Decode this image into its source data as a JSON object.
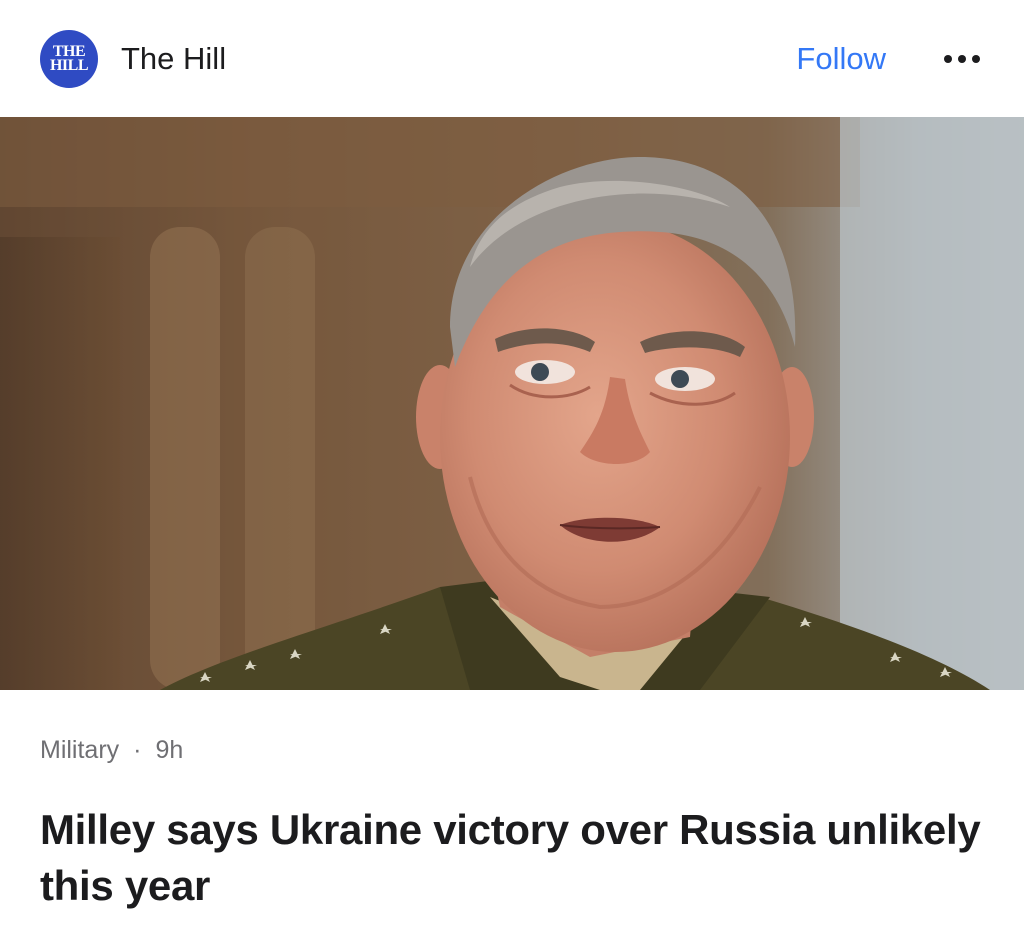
{
  "header": {
    "logo_text_line1": "THE",
    "logo_text_line2": "HILL",
    "source_name": "The Hill",
    "follow_label": "Follow",
    "more_icon": "ellipsis-icon"
  },
  "article": {
    "category": "Military",
    "separator": "·",
    "age": "9h",
    "headline": "Milley says Ukraine victory over Russia unlikely this year"
  },
  "colors": {
    "accent": "#3478f6",
    "logo_bg": "#2f4bc3",
    "text": "#1c1c1e",
    "meta": "#6f6f73"
  }
}
